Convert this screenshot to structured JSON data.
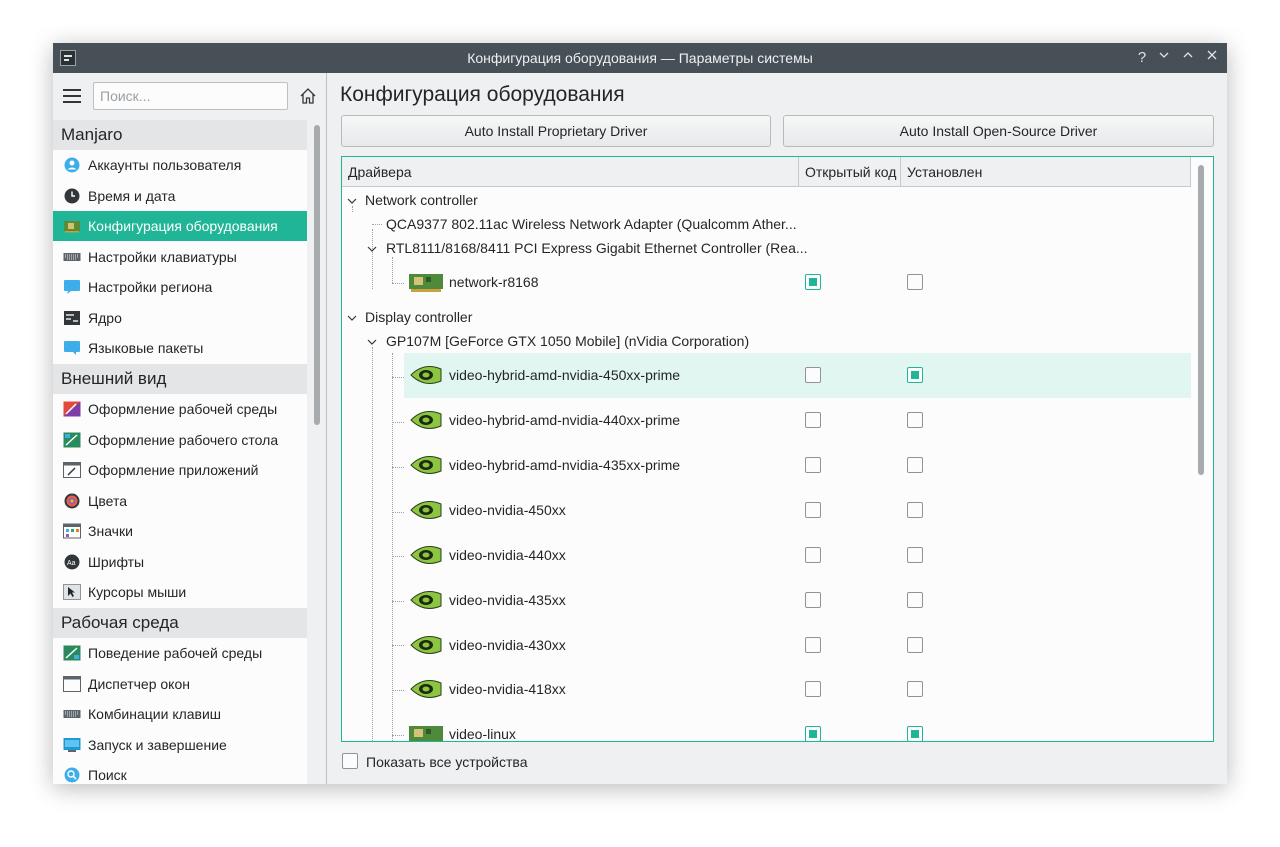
{
  "window": {
    "title": "Конфигурация оборудования — Параметры системы",
    "controls": [
      "?",
      "⌄",
      "⌃",
      "✕"
    ]
  },
  "search": {
    "placeholder": "Поиск..."
  },
  "sidebar": {
    "categories": [
      {
        "title": "Manjaro",
        "items": [
          {
            "label": "Аккаунты пользователя",
            "icon": "user-accounts-icon"
          },
          {
            "label": "Время и дата",
            "icon": "clock-icon"
          },
          {
            "label": "Конфигурация оборудования",
            "icon": "hardware-icon",
            "selected": true
          },
          {
            "label": "Настройки клавиатуры",
            "icon": "keyboard-icon"
          },
          {
            "label": "Настройки региона",
            "icon": "region-icon"
          },
          {
            "label": "Ядро",
            "icon": "kernel-icon"
          },
          {
            "label": "Языковые пакеты",
            "icon": "language-packs-icon"
          }
        ]
      },
      {
        "title": "Внешний вид",
        "items": [
          {
            "label": "Оформление рабочей среды",
            "icon": "workspace-theme-icon"
          },
          {
            "label": "Оформление рабочего стола",
            "icon": "desktop-theme-icon"
          },
          {
            "label": "Оформление приложений",
            "icon": "app-style-icon"
          },
          {
            "label": "Цвета",
            "icon": "colors-icon"
          },
          {
            "label": "Значки",
            "icon": "icons-icon"
          },
          {
            "label": "Шрифты",
            "icon": "fonts-icon"
          },
          {
            "label": "Курсоры мыши",
            "icon": "cursors-icon"
          }
        ]
      },
      {
        "title": "Рабочая среда",
        "items": [
          {
            "label": "Поведение рабочей среды",
            "icon": "workspace-behavior-icon"
          },
          {
            "label": "Диспетчер окон",
            "icon": "window-manager-icon"
          },
          {
            "label": "Комбинации клавиш",
            "icon": "shortcuts-icon"
          },
          {
            "label": "Запуск и завершение",
            "icon": "startup-icon"
          },
          {
            "label": "Поиск",
            "icon": "search-icon"
          }
        ]
      }
    ]
  },
  "main": {
    "title": "Конфигурация оборудования",
    "buttons": {
      "proprietary": "Auto Install Proprietary Driver",
      "open_source": "Auto Install Open-Source Driver"
    },
    "columns": [
      "Драйвера",
      "Открытый код",
      "Установлен"
    ],
    "tree": {
      "network": {
        "label": "Network controller",
        "devices": [
          {
            "label": "QCA9377 802.11ac Wireless Network Adapter (Qualcomm Ather..."
          },
          {
            "label": "RTL8111/8168/8411 PCI Express Gigabit Ethernet Controller (Rea...",
            "drivers": [
              {
                "name": "network-r8168",
                "open_source": true,
                "installed": false,
                "icon": "pci-card-icon"
              }
            ]
          }
        ]
      },
      "display": {
        "label": "Display controller",
        "devices": [
          {
            "label": "GP107M [GeForce GTX 1050 Mobile] (nVidia Corporation)",
            "drivers": [
              {
                "name": "video-hybrid-amd-nvidia-450xx-prime",
                "open_source": false,
                "installed": true,
                "selected": true,
                "icon": "nvidia-icon"
              },
              {
                "name": "video-hybrid-amd-nvidia-440xx-prime",
                "open_source": false,
                "installed": false,
                "icon": "nvidia-icon"
              },
              {
                "name": "video-hybrid-amd-nvidia-435xx-prime",
                "open_source": false,
                "installed": false,
                "icon": "nvidia-icon"
              },
              {
                "name": "video-nvidia-450xx",
                "open_source": false,
                "installed": false,
                "icon": "nvidia-icon"
              },
              {
                "name": "video-nvidia-440xx",
                "open_source": false,
                "installed": false,
                "icon": "nvidia-icon"
              },
              {
                "name": "video-nvidia-435xx",
                "open_source": false,
                "installed": false,
                "icon": "nvidia-icon"
              },
              {
                "name": "video-nvidia-430xx",
                "open_source": false,
                "installed": false,
                "icon": "nvidia-icon"
              },
              {
                "name": "video-nvidia-418xx",
                "open_source": false,
                "installed": false,
                "icon": "nvidia-icon"
              },
              {
                "name": "video-linux",
                "open_source": true,
                "installed": true,
                "icon": "pci-card-icon"
              }
            ]
          }
        ]
      }
    },
    "show_all_label": "Показать все устройства",
    "show_all_checked": false
  },
  "colors": {
    "accent": "#1fb596",
    "titlebar": "#475057",
    "selected_row": "#e1f5f1"
  }
}
